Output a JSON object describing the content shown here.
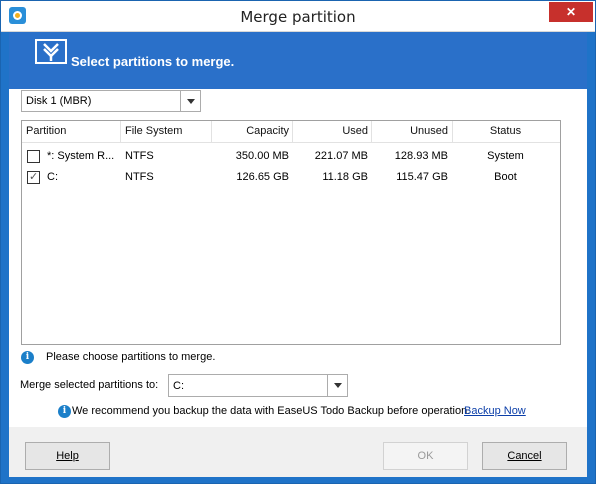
{
  "window": {
    "title": "Merge partition",
    "close_label": "✕"
  },
  "banner": {
    "heading": "Select partitions to merge."
  },
  "disk_select": {
    "value": "Disk 1 (MBR)"
  },
  "table": {
    "columns": [
      "Partition",
      "File System",
      "Capacity",
      "Used",
      "Unused",
      "Status"
    ],
    "rows": [
      {
        "checked": false,
        "partition": "*: System R...",
        "fs": "NTFS",
        "capacity": "350.00 MB",
        "used": "221.07 MB",
        "unused": "128.93 MB",
        "status": "System"
      },
      {
        "checked": true,
        "partition": "C:",
        "fs": "NTFS",
        "capacity": "126.65 GB",
        "used": "11.18 GB",
        "unused": "115.47 GB",
        "status": "Boot"
      }
    ]
  },
  "hint": {
    "icon": "info-icon",
    "text": "Please choose partitions to merge."
  },
  "merge_target": {
    "label": "Merge selected partitions to:",
    "value": "C:"
  },
  "recommend": {
    "text": "We recommend you backup the data with EaseUS Todo Backup before operation.",
    "link": "Backup Now"
  },
  "footer": {
    "help": "Help",
    "ok": "OK",
    "cancel": "Cancel"
  },
  "colors": {
    "accent": "#2a70c9",
    "frame": "#1f73c8",
    "close": "#c7302c"
  }
}
